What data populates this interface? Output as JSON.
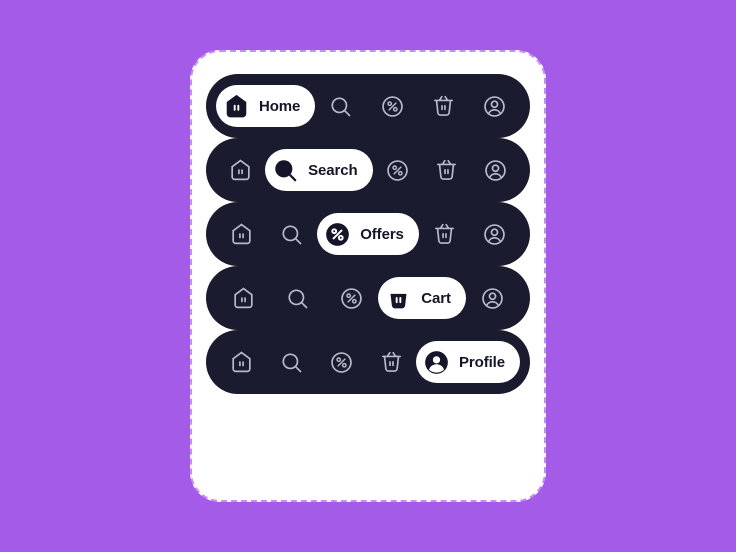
{
  "page": {
    "background_color": "#a45ce8",
    "card_color": "#ffffff",
    "navbar_color": "#1b1b2f",
    "active_pill_color": "#ffffff",
    "active_text_color": "#15152a",
    "inactive_icon_color": "#b9b9cc",
    "dashed_border_color": "#c78ef0"
  },
  "nav_items": [
    {
      "id": "home",
      "label": "Home",
      "icon": "home-icon"
    },
    {
      "id": "search",
      "label": "Search",
      "icon": "search-icon"
    },
    {
      "id": "offers",
      "label": "Offers",
      "icon": "percent-circle-icon"
    },
    {
      "id": "cart",
      "label": "Cart",
      "icon": "basket-icon"
    },
    {
      "id": "profile",
      "label": "Profile",
      "icon": "user-circle-icon"
    }
  ],
  "navbars": [
    {
      "active_index": 0,
      "active_label": "Home"
    },
    {
      "active_index": 1,
      "active_label": "Search"
    },
    {
      "active_index": 2,
      "active_label": "Offers"
    },
    {
      "active_index": 3,
      "active_label": "Cart"
    },
    {
      "active_index": 4,
      "active_label": "Profile"
    }
  ]
}
